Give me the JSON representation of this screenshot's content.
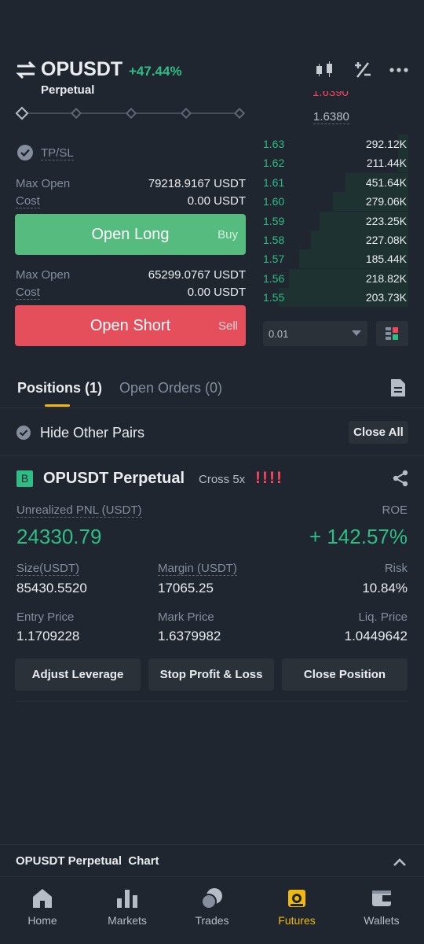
{
  "header": {
    "pair": "OPUSDT",
    "change": "+47.44%",
    "contract": "Perpetual"
  },
  "orderbook_top": {
    "partial_ask": "1.6390",
    "mark": "1.6380"
  },
  "form": {
    "tpsl_label": "TP/SL",
    "long": {
      "max_open_label": "Max Open",
      "max_open_value": "79218.9167 USDT",
      "cost_label": "Cost",
      "cost_value": "0.00 USDT",
      "button_label": "Open Long",
      "button_tag": "Buy"
    },
    "short": {
      "max_open_label": "Max Open",
      "max_open_value": "65299.0767 USDT",
      "cost_label": "Cost",
      "cost_value": "0.00 USDT",
      "button_label": "Open Short",
      "button_tag": "Sell"
    }
  },
  "orderbook": {
    "bids": [
      {
        "price": "1.63",
        "amount": "292.12K",
        "depth": 0.07
      },
      {
        "price": "1.62",
        "amount": "211.44K",
        "depth": 0.07
      },
      {
        "price": "1.61",
        "amount": "451.64K",
        "depth": 0.43
      },
      {
        "price": "1.60",
        "amount": "279.06K",
        "depth": 0.52
      },
      {
        "price": "1.59",
        "amount": "223.25K",
        "depth": 0.61
      },
      {
        "price": "1.58",
        "amount": "227.08K",
        "depth": 0.67
      },
      {
        "price": "1.57",
        "amount": "185.44K",
        "depth": 0.75
      },
      {
        "price": "1.56",
        "amount": "218.82K",
        "depth": 0.82
      },
      {
        "price": "1.55",
        "amount": "203.73K",
        "depth": 0.89
      }
    ],
    "precision": "0.01"
  },
  "tabs": {
    "positions": "Positions (1)",
    "open_orders": "Open Orders (0)"
  },
  "filter": {
    "hide_pairs": "Hide Other Pairs",
    "close_all": "Close All"
  },
  "position": {
    "side_badge": "B",
    "symbol": "OPUSDT Perpetual",
    "margin_mode": "Cross 5x",
    "risk_flags": "!!!!",
    "pnl_label": "Unrealized PNL (USDT)",
    "pnl_value": "24330.79",
    "roe_label": "ROE",
    "roe_value": "+ 142.57%",
    "size_label": "Size(USDT)",
    "size_value": "85430.5520",
    "margin_label": "Margin (USDT)",
    "margin_value": "17065.25",
    "risk_label": "Risk",
    "risk_value": "10.84%",
    "entry_label": "Entry Price",
    "entry_value": "1.1709228",
    "mark_label": "Mark Price",
    "mark_value": "1.6379982",
    "liq_label": "Liq. Price",
    "liq_value": "1.0449642",
    "btn_adjust": "Adjust Leverage",
    "btn_tpsl": "Stop Profit & Loss",
    "btn_close": "Close Position"
  },
  "chart_bar": {
    "label": "OPUSDT Perpetual  Chart"
  },
  "nav": [
    {
      "label": "Home",
      "icon": "home-icon"
    },
    {
      "label": "Markets",
      "icon": "markets-icon"
    },
    {
      "label": "Trades",
      "icon": "trades-icon"
    },
    {
      "label": "Futures",
      "icon": "futures-icon"
    },
    {
      "label": "Wallets",
      "icon": "wallets-icon"
    }
  ],
  "colors": {
    "background": "#1f2630",
    "green": "#2ebd85",
    "red": "#f6465d",
    "accent": "#f0b90b"
  }
}
